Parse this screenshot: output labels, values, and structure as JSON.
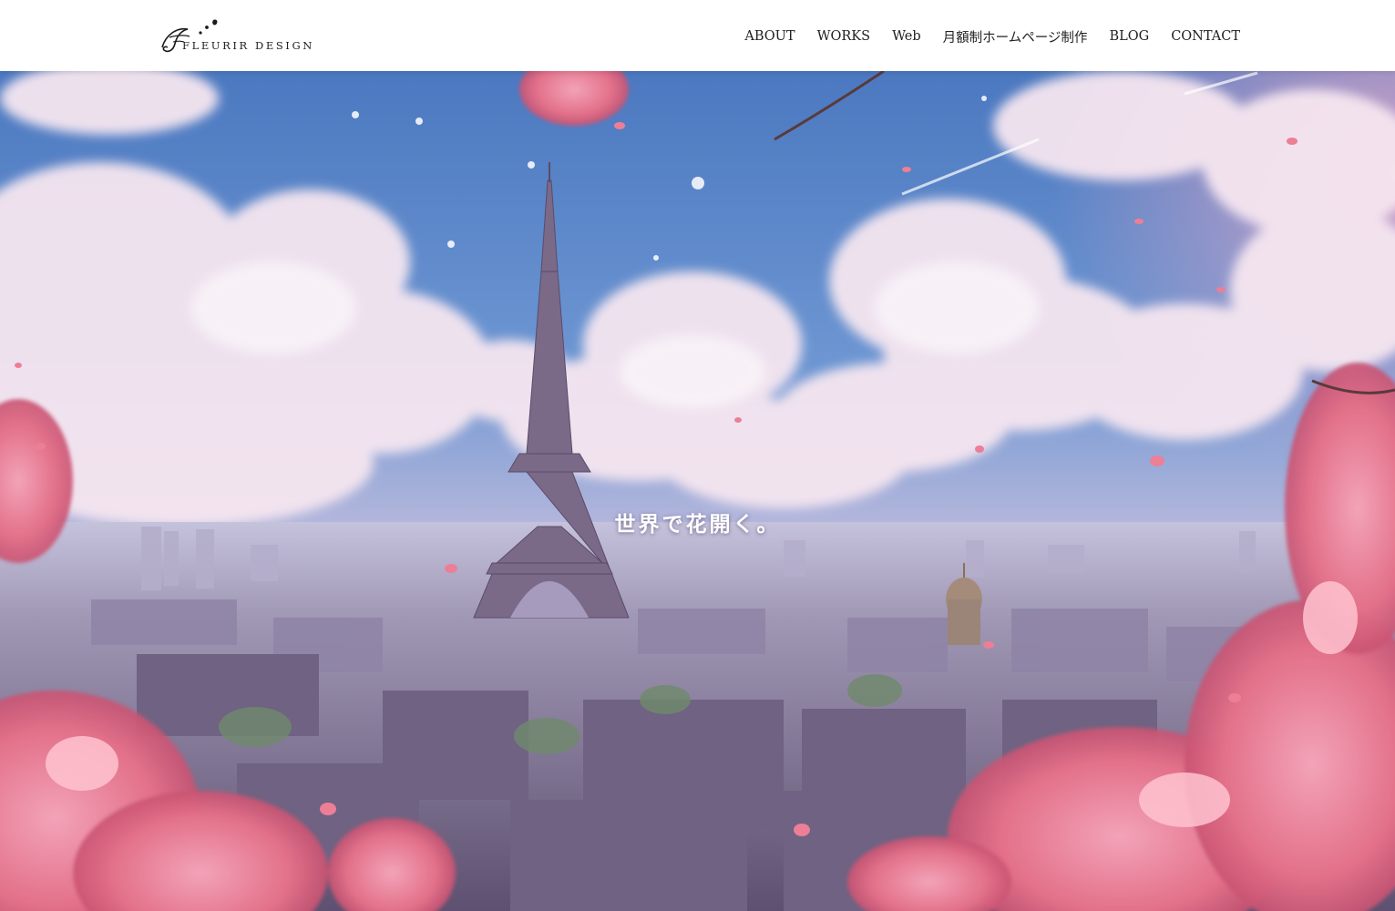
{
  "brand": {
    "logo_text": "FLEURIR DESIGN"
  },
  "nav": {
    "items": [
      {
        "label": "ABOUT"
      },
      {
        "label": "WORKS"
      },
      {
        "label": "Web"
      },
      {
        "label": "月額制ホームページ制作"
      },
      {
        "label": "BLOG"
      },
      {
        "label": "CONTACT"
      }
    ]
  },
  "hero": {
    "tagline": "世界で花開く。",
    "scene": "eiffel-tower-cherry-blossom-cityscape",
    "colors": {
      "sky_top": "#4f7fc4",
      "sky_bottom": "#bcb4d8",
      "cloud": "#f4e4ee",
      "blossom": "#e8788f",
      "city": "#8a7f9c"
    }
  },
  "theme": {
    "header_bg": "#ffffff",
    "nav_text": "#222222"
  }
}
